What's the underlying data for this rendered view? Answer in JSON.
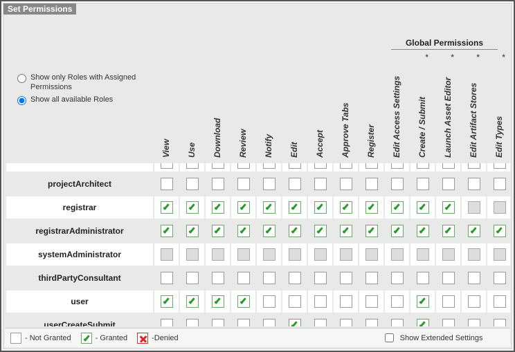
{
  "title": "Set Permissions",
  "globalPermissionsLabel": "Global Permissions",
  "radios": {
    "assigned": "Show only Roles with Assigned Permissions",
    "all": "Show all available Roles",
    "selected": "all"
  },
  "columns": [
    {
      "key": "view",
      "label": "View",
      "ast": false,
      "global": false
    },
    {
      "key": "use",
      "label": "Use",
      "ast": false,
      "global": false
    },
    {
      "key": "download",
      "label": "Download",
      "ast": false,
      "global": false
    },
    {
      "key": "review",
      "label": "Review",
      "ast": false,
      "global": false
    },
    {
      "key": "notify",
      "label": "Notify",
      "ast": false,
      "global": false
    },
    {
      "key": "edit",
      "label": "Edit",
      "ast": false,
      "global": false
    },
    {
      "key": "accept",
      "label": "Accept",
      "ast": false,
      "global": false
    },
    {
      "key": "approveTabs",
      "label": "Approve Tabs",
      "ast": false,
      "global": false
    },
    {
      "key": "register",
      "label": "Register",
      "ast": false,
      "global": false
    },
    {
      "key": "editAccessSettings",
      "label": "Edit Access Settings",
      "ast": false,
      "global": false
    },
    {
      "key": "createSubmit",
      "label": "Create / Submit",
      "ast": true,
      "global": true
    },
    {
      "key": "launchAssetEditor",
      "label": "Launch Asset Editor",
      "ast": true,
      "global": true
    },
    {
      "key": "editArtifactStores",
      "label": "Edit Artifact Stores",
      "ast": true,
      "global": true
    },
    {
      "key": "editTypes",
      "label": "Edit Types",
      "ast": true,
      "global": true
    }
  ],
  "roles": [
    {
      "name": "",
      "cut": true,
      "cells": [
        "u",
        "u",
        "u",
        "u",
        "u",
        "u",
        "u",
        "u",
        "u",
        "u",
        "u",
        "u",
        "u",
        "u"
      ]
    },
    {
      "name": "projectArchitect",
      "cells": [
        "u",
        "u",
        "u",
        "u",
        "u",
        "u",
        "u",
        "u",
        "u",
        "u",
        "u",
        "u",
        "u",
        "u"
      ]
    },
    {
      "name": "registrar",
      "cells": [
        "g",
        "g",
        "g",
        "g",
        "g",
        "g",
        "g",
        "g",
        "g",
        "g",
        "g",
        "g",
        "d",
        "d"
      ]
    },
    {
      "name": "registrarAdministrator",
      "cells": [
        "g",
        "g",
        "g",
        "g",
        "g",
        "g",
        "g",
        "g",
        "g",
        "g",
        "g",
        "g",
        "g",
        "g"
      ]
    },
    {
      "name": "systemAdministrator",
      "cells": [
        "d",
        "d",
        "d",
        "d",
        "d",
        "d",
        "d",
        "d",
        "d",
        "d",
        "d",
        "d",
        "d",
        "d"
      ]
    },
    {
      "name": "thirdPartyConsultant",
      "cells": [
        "u",
        "u",
        "u",
        "u",
        "u",
        "u",
        "u",
        "u",
        "u",
        "u",
        "u",
        "u",
        "u",
        "u"
      ]
    },
    {
      "name": "user",
      "cells": [
        "g",
        "g",
        "g",
        "g",
        "u",
        "u",
        "u",
        "u",
        "u",
        "u",
        "g",
        "u",
        "u",
        "u"
      ]
    },
    {
      "name": "userCreateSubmit",
      "cells": [
        "u",
        "u",
        "u",
        "u",
        "u",
        "g",
        "u",
        "u",
        "u",
        "u",
        "g",
        "u",
        "u",
        "u"
      ]
    }
  ],
  "legend": {
    "notGranted": "- Not Granted",
    "granted": "- Granted",
    "denied": "-Denied"
  },
  "showExtended": {
    "label": "Show Extended Settings",
    "checked": false
  }
}
